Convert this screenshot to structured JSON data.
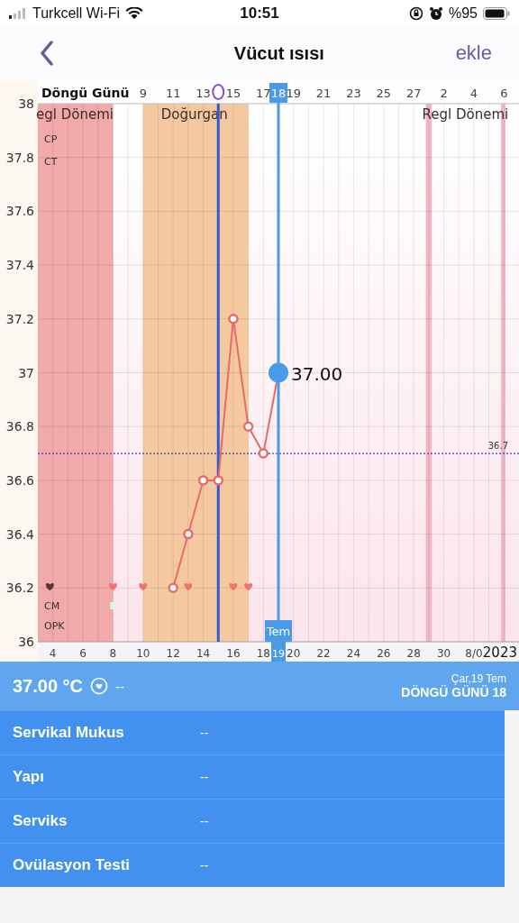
{
  "status_bar": {
    "carrier": "Turkcell Wi-Fi",
    "time": "10:51",
    "battery": "%95"
  },
  "nav": {
    "title": "Vücut ısısı",
    "action": "ekle"
  },
  "chart": {
    "cycle_axis": {
      "title": "Döngü Günü",
      "labels": [
        "9",
        "11",
        "13",
        "15",
        "17",
        "19",
        "21",
        "23",
        "25",
        "27",
        "2",
        "4",
        "6"
      ]
    },
    "row_labels": [
      "CP",
      "CT",
      "CM",
      "OPK"
    ],
    "year": "2023",
    "markers": [
      {
        "kind": "heart",
        "color": "#5a3838"
      },
      {
        "kind": "heart",
        "color": "#f07272"
      },
      {
        "kind": "heart",
        "color": "#f07272"
      },
      {
        "kind": "heart",
        "color": "#f07272"
      },
      {
        "kind": "heart",
        "color": "#f07272"
      },
      {
        "kind": "heart",
        "color": "#f07272"
      },
      {
        "kind": "cm",
        "color": "#d8f4f4"
      }
    ],
    "selection": {
      "top_label": "18",
      "month": "Tem",
      "day": "19",
      "value_label": "37.00"
    },
    "chart_data": {
      "type": "line",
      "x": [
        12,
        13,
        14,
        15,
        16,
        17,
        18,
        19
      ],
      "series": [
        {
          "color": "#e86a6a",
          "marker": "o",
          "values": [
            36.2,
            36.4,
            36.6,
            36.6,
            37.2,
            36.8,
            36.7,
            37.0
          ]
        }
      ],
      "xlim": [
        3,
        35
      ],
      "ylim": [
        36,
        38
      ],
      "grid": true,
      "xticks": [
        4,
        6,
        8,
        10,
        12,
        14,
        16,
        18,
        20,
        22,
        24,
        26,
        28,
        30,
        {
          "value": 32,
          "label": "8/0"
        }
      ],
      "yticks": [
        36,
        36.2,
        36.4,
        36.6,
        36.8,
        37,
        37.2,
        37.4,
        37.6,
        37.8,
        38
      ],
      "bands": [
        {
          "axis": "x",
          "from": 3,
          "to": 8,
          "label": "egl Dönemi",
          "color": "#f2a9a9"
        },
        {
          "axis": "x",
          "from": 10,
          "to": 17,
          "label": "Doğurgan",
          "color": "#f5c9a0"
        },
        {
          "axis": "x",
          "from": 28.8,
          "to": 29.2,
          "label": "Regl Dönemi",
          "color": "#f3b8c6"
        },
        {
          "axis": "x",
          "from": 33.8,
          "to": 34.1,
          "color": "#f3b8c6"
        }
      ],
      "ref_lines": [
        {
          "axis": "y",
          "value": 36.7,
          "label": "36.7",
          "color": "#3a3ac8"
        },
        {
          "axis": "x",
          "value": 15,
          "color": "#2a5ad8"
        },
        {
          "axis": "x",
          "value": 19,
          "color": "#4a9ae8"
        }
      ]
    }
  },
  "summary": {
    "temperature": "37.00 °C",
    "sex": "--",
    "date": "Çar,19 Tem",
    "cycle_day": "DÖNGÜ GÜNÜ 18"
  },
  "rows": [
    {
      "label": "Servikal Mukus",
      "value": "--"
    },
    {
      "label": "Yapı",
      "value": "--"
    },
    {
      "label": "Serviks",
      "value": "--"
    },
    {
      "label": "Ovülasyon Testi",
      "value": "--"
    }
  ]
}
